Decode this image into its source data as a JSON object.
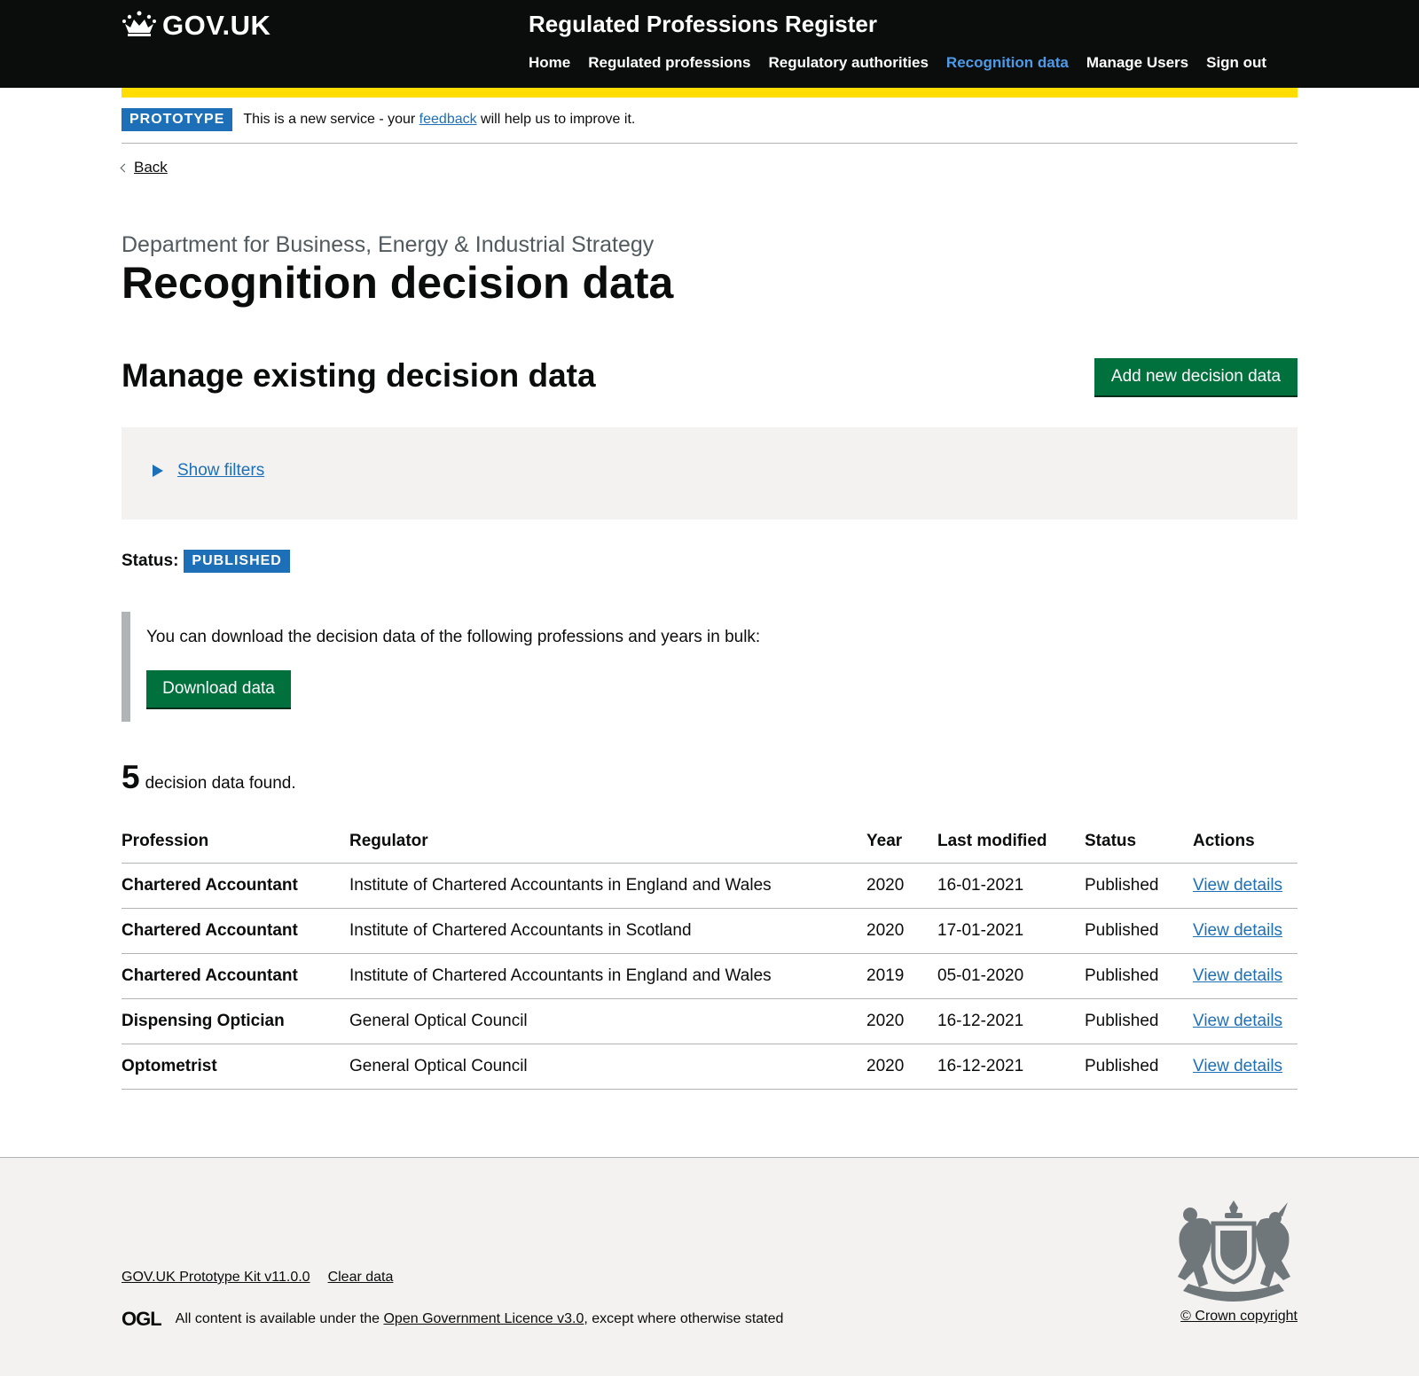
{
  "header": {
    "logo_text": "GOV.UK",
    "service_name": "Regulated Professions Register",
    "nav": [
      {
        "label": "Home"
      },
      {
        "label": "Regulated professions"
      },
      {
        "label": "Regulatory authorities"
      },
      {
        "label": "Recognition data",
        "active": true
      },
      {
        "label": "Manage Users"
      },
      {
        "label": "Sign out"
      }
    ]
  },
  "phase_banner": {
    "tag": "PROTOTYPE",
    "text_before": "This is a new service - your ",
    "link": "feedback",
    "text_after": " will help us to improve it."
  },
  "back_link": "Back",
  "page": {
    "caption": "Department for Business, Energy & Industrial Strategy",
    "title": "Recognition decision data",
    "subheading": "Manage existing decision data",
    "add_button": "Add new decision data",
    "filters_toggle": "Show filters",
    "status_label": "Status:",
    "status_tag": "PUBLISHED",
    "download_text": "You can download the decision data of the following professions and years in bulk:",
    "download_button": "Download data",
    "count": "5",
    "count_text": "decision data found."
  },
  "table": {
    "headers": [
      "Profession",
      "Regulator",
      "Year",
      "Last modified",
      "Status",
      "Actions"
    ],
    "rows": [
      {
        "profession": "Chartered Accountant",
        "regulator": "Institute of Chartered Accountants in England and Wales",
        "year": "2020",
        "modified": "16-01-2021",
        "status": "Published",
        "action": "View details"
      },
      {
        "profession": "Chartered Accountant",
        "regulator": "Institute of Chartered Accountants in Scotland",
        "year": "2020",
        "modified": "17-01-2021",
        "status": "Published",
        "action": "View details"
      },
      {
        "profession": "Chartered Accountant",
        "regulator": "Institute of Chartered Accountants in England and Wales",
        "year": "2019",
        "modified": "05-01-2020",
        "status": "Published",
        "action": "View details"
      },
      {
        "profession": "Dispensing Optician",
        "regulator": "General Optical Council",
        "year": "2020",
        "modified": "16-12-2021",
        "status": "Published",
        "action": "View details"
      },
      {
        "profession": "Optometrist",
        "regulator": "General Optical Council",
        "year": "2020",
        "modified": "16-12-2021",
        "status": "Published",
        "action": "View details"
      }
    ]
  },
  "footer": {
    "links": [
      "GOV.UK Prototype Kit v11.0.0",
      "Clear data"
    ],
    "ogl": "OGL",
    "licence_before": "All content is available under the ",
    "licence_link": "Open Government Licence v3.0",
    "licence_after": ", except where otherwise stated",
    "copyright": "© Crown copyright"
  },
  "colors": {
    "header_bg": "#0b0c0c",
    "accent_yellow": "#ffdd00",
    "link_blue": "#1d70b8",
    "button_green": "#00703c",
    "footer_bg": "#f3f2f1"
  }
}
